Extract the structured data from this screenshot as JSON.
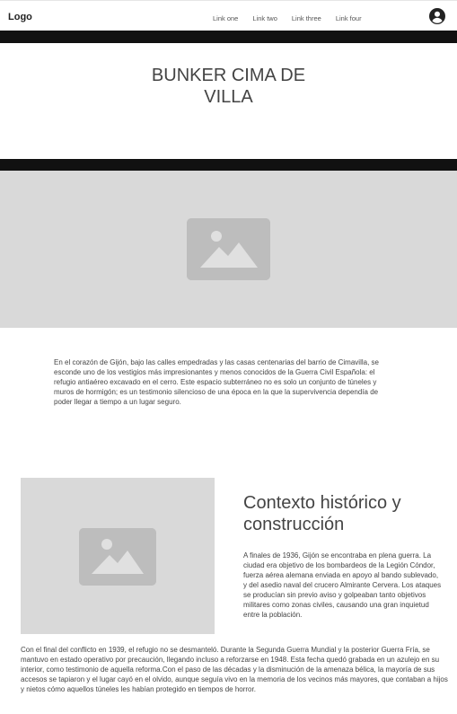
{
  "navbar": {
    "logo": "Logo",
    "links": [
      "Link one",
      "Link two",
      "Link three",
      "Link four"
    ],
    "account_icon": "account-circle-icon"
  },
  "hero": {
    "title_line1": "BUNKER CIMA DE",
    "title_line2": "VILLA",
    "image_icon": "image-placeholder-icon"
  },
  "intro": {
    "text": "En el corazón de Gijón, bajo las calles empedradas y las casas centenarias del barrio de Cimavilla, se esconde uno de los vestigios más impresionantes y menos conocidos de la Guerra Civil Española: el refugio antiaéreo excavado en el cerro. Este espacio subterráneo no es solo un conjunto de túneles y muros de hormigón; es un testimonio silencioso de una época en la que la supervivencia dependía de poder llegar a tiempo a un lugar seguro."
  },
  "section": {
    "heading": "Contexto histórico y construcción",
    "paragraph": "A finales de 1936, Gijón se encontraba en plena guerra. La ciudad era objetivo de los bombardeos de la Legión Cóndor, fuerza aérea alemana enviada en apoyo al bando sublevado, y del asedio naval del crucero Almirante Cervera. Los ataques se producían sin previo aviso y golpeaban tanto objetivos militares como zonas civiles, causando una gran inquietud entre la población.",
    "closing": "Con el final del conflicto en 1939, el refugio no se desmanteló. Durante la Segunda Guerra Mundial y la posterior Guerra Fría, se mantuvo en estado operativo por precaución, llegando incluso a reforzarse en 1948. Esta fecha quedó grabada en un azulejo en su interior, como testimonio de aquella reforma.Con el paso de las décadas y la disminución de la amenaza bélica, la mayoría de sus accesos se tapiaron y el lugar cayó en el olvido, aunque seguía vivo en la memoria de los vecinos más mayores, que contaban a hijos y nietos cómo aquellos túneles les habían protegido en tiempos de horror."
  },
  "colors": {
    "bar": "#111111",
    "placeholder_bg": "#d9d9d9",
    "placeholder_icon": "#bdbdbd",
    "text": "#444444"
  }
}
